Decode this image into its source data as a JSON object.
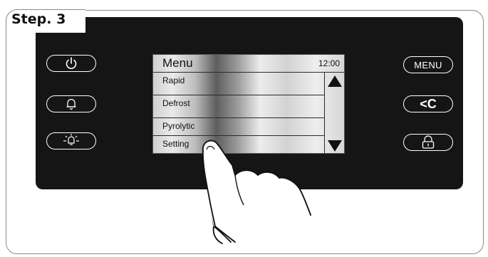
{
  "step": {
    "label": "Step. 3"
  },
  "screen": {
    "title": "Menu",
    "clock": "12:00",
    "items": [
      {
        "label": "Rapid"
      },
      {
        "label": "Defrost"
      },
      {
        "label": "Pyrolytic"
      },
      {
        "label": "Setting"
      }
    ]
  },
  "buttons": {
    "left": [
      {
        "icon": "power-icon"
      },
      {
        "icon": "bell-icon"
      },
      {
        "icon": "light-icon"
      }
    ],
    "right": [
      {
        "label": "MENU"
      },
      {
        "label": "<C",
        "icon": "back-icon"
      },
      {
        "icon": "lock-icon"
      }
    ]
  },
  "colors": {
    "panel": "#151515",
    "frame": "#8a8a8a",
    "button_outline": "#ffffff"
  }
}
